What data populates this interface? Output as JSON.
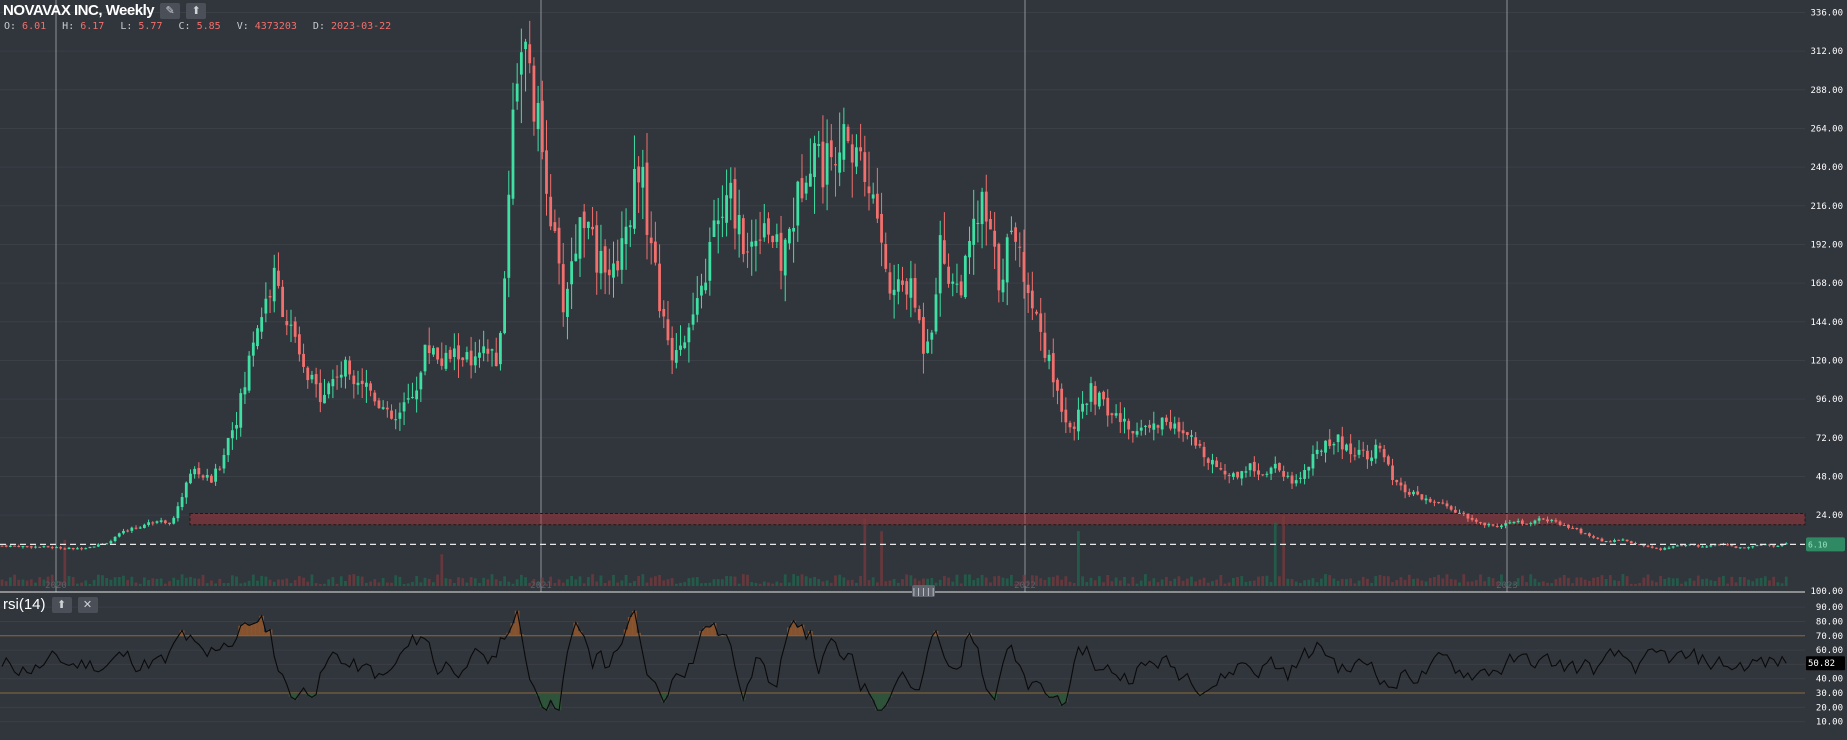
{
  "header": {
    "title": "NOVAVAX INC, Weekly",
    "ohlc": [
      {
        "key": "O:",
        "value": "6.01"
      },
      {
        "key": "H:",
        "value": "6.17"
      },
      {
        "key": "L:",
        "value": "5.77"
      },
      {
        "key": "C:",
        "value": "5.85"
      },
      {
        "key": "V:",
        "value": "4373203"
      },
      {
        "key": "D:",
        "value": "2023-03-22"
      }
    ]
  },
  "rsi_panel": {
    "title": "rsi(14)"
  },
  "colors": {
    "background": "#31353c",
    "grid": "#3b3f46",
    "up": "#3fe0a4",
    "down": "#f1706d",
    "rsi_line": "#0a0a0a",
    "rsi_overbought_fill": "#9a5a2c",
    "rsi_oversold_fill": "#2f5a3a",
    "resistance_zone": "#b5343a",
    "last_price_badge": "#2f8a64"
  },
  "icons": [
    "pencil-icon",
    "up-arrow-icon",
    "close-icon",
    "drag-handle-icon"
  ],
  "chart_data": [
    {
      "type": "candlestick",
      "series_name": "NOVAVAX INC",
      "interval": "Weekly",
      "x_tick_labels": [
        "2020",
        "2021",
        "2022",
        "2023"
      ],
      "y_tick_labels": [
        "336.00",
        "312.00",
        "288.00",
        "264.00",
        "240.00",
        "216.00",
        "192.00",
        "168.00",
        "144.00",
        "120.00",
        "96.00",
        "72.00",
        "48.00",
        "24.00",
        "100.00"
      ],
      "ylim": [
        -20,
        340
      ],
      "last_price": 5.85,
      "last_price_label": "6.10",
      "resistance_zone": [
        18,
        25
      ],
      "approx_close_path": [
        [
          0,
          5
        ],
        [
          12,
          4
        ],
        [
          18,
          3
        ],
        [
          22,
          5
        ],
        [
          24,
          6
        ],
        [
          26,
          8
        ],
        [
          28,
          12
        ],
        [
          30,
          15
        ],
        [
          33,
          17
        ],
        [
          36,
          20
        ],
        [
          38,
          22
        ],
        [
          40,
          18
        ],
        [
          42,
          28
        ],
        [
          44,
          45
        ],
        [
          46,
          52
        ],
        [
          48,
          48
        ],
        [
          50,
          45
        ],
        [
          52,
          55
        ],
        [
          54,
          72
        ],
        [
          56,
          85
        ],
        [
          58,
          105
        ],
        [
          60,
          135
        ],
        [
          62,
          150
        ],
        [
          63,
          158
        ],
        [
          65,
          170
        ],
        [
          67,
          155
        ],
        [
          68,
          145
        ],
        [
          70,
          130
        ],
        [
          72,
          112
        ],
        [
          74,
          105
        ],
        [
          76,
          100
        ],
        [
          78,
          105
        ],
        [
          80,
          112
        ],
        [
          82,
          115
        ],
        [
          84,
          112
        ],
        [
          86,
          108
        ],
        [
          88,
          102
        ],
        [
          90,
          95
        ],
        [
          92,
          85
        ],
        [
          94,
          82
        ],
        [
          96,
          90
        ],
        [
          98,
          100
        ],
        [
          100,
          112
        ],
        [
          101,
          125
        ],
        [
          103,
          130
        ],
        [
          105,
          118
        ],
        [
          107,
          122
        ],
        [
          110,
          125
        ],
        [
          112,
          115
        ],
        [
          114,
          120
        ],
        [
          116,
          125
        ],
        [
          118,
          122
        ],
        [
          119,
          130
        ],
        [
          120,
          170
        ],
        [
          121,
          230
        ],
        [
          122,
          280
        ],
        [
          123,
          300
        ],
        [
          124,
          320
        ],
        [
          125,
          310
        ],
        [
          126,
          290
        ],
        [
          128,
          265
        ],
        [
          130,
          235
        ],
        [
          132,
          190
        ],
        [
          134,
          155
        ],
        [
          136,
          180
        ],
        [
          138,
          205
        ],
        [
          140,
          215
        ],
        [
          142,
          170
        ],
        [
          144,
          185
        ],
        [
          146,
          175
        ],
        [
          148,
          195
        ],
        [
          150,
          215
        ],
        [
          152,
          245
        ],
        [
          154,
          210
        ],
        [
          156,
          175
        ],
        [
          158,
          140
        ],
        [
          160,
          125
        ],
        [
          162,
          135
        ],
        [
          164,
          140
        ],
        [
          166,
          150
        ],
        [
          168,
          175
        ],
        [
          170,
          200
        ],
        [
          172,
          210
        ],
        [
          174,
          220
        ],
        [
          176,
          205
        ],
        [
          178,
          185
        ],
        [
          180,
          200
        ],
        [
          182,
          210
        ],
        [
          184,
          195
        ],
        [
          186,
          180
        ],
        [
          188,
          200
        ],
        [
          190,
          220
        ],
        [
          192,
          245
        ],
        [
          194,
          255
        ],
        [
          196,
          240
        ],
        [
          198,
          250
        ],
        [
          200,
          262
        ],
        [
          202,
          245
        ],
        [
          204,
          255
        ],
        [
          206,
          235
        ],
        [
          208,
          220
        ],
        [
          210,
          195
        ],
        [
          212,
          160
        ],
        [
          214,
          165
        ],
        [
          216,
          168
        ],
        [
          218,
          155
        ],
        [
          220,
          130
        ],
        [
          222,
          145
        ],
        [
          224,
          190
        ],
        [
          226,
          175
        ],
        [
          228,
          165
        ],
        [
          230,
          175
        ],
        [
          232,
          200
        ],
        [
          234,
          215
        ],
        [
          236,
          195
        ],
        [
          238,
          170
        ],
        [
          240,
          190
        ],
        [
          242,
          200
        ],
        [
          244,
          175
        ],
        [
          246,
          155
        ],
        [
          248,
          140
        ],
        [
          250,
          118
        ],
        [
          252,
          100
        ],
        [
          254,
          85
        ],
        [
          256,
          80
        ],
        [
          258,
          90
        ],
        [
          260,
          100
        ],
        [
          262,
          95
        ],
        [
          264,
          88
        ],
        [
          266,
          85
        ],
        [
          268,
          80
        ],
        [
          270,
          75
        ],
        [
          272,
          82
        ],
        [
          274,
          78
        ],
        [
          276,
          80
        ],
        [
          278,
          85
        ],
        [
          280,
          78
        ],
        [
          282,
          72
        ],
        [
          284,
          70
        ],
        [
          286,
          65
        ],
        [
          288,
          60
        ],
        [
          290,
          55
        ],
        [
          292,
          50
        ],
        [
          294,
          48
        ],
        [
          296,
          52
        ],
        [
          298,
          55
        ],
        [
          300,
          50
        ],
        [
          302,
          52
        ],
        [
          304,
          55
        ],
        [
          306,
          50
        ],
        [
          308,
          45
        ],
        [
          310,
          48
        ],
        [
          312,
          55
        ],
        [
          314,
          62
        ],
        [
          316,
          70
        ],
        [
          318,
          72
        ],
        [
          320,
          68
        ],
        [
          322,
          63
        ],
        [
          324,
          65
        ],
        [
          326,
          62
        ],
        [
          328,
          65
        ],
        [
          330,
          60
        ],
        [
          332,
          45
        ],
        [
          334,
          40
        ],
        [
          336,
          38
        ],
        [
          338,
          35
        ],
        [
          340,
          33
        ],
        [
          342,
          32
        ],
        [
          344,
          30
        ],
        [
          346,
          28
        ],
        [
          348,
          25
        ],
        [
          350,
          22
        ],
        [
          352,
          20
        ],
        [
          354,
          18
        ],
        [
          356,
          17
        ],
        [
          358,
          18
        ],
        [
          360,
          19
        ],
        [
          362,
          20
        ],
        [
          364,
          18
        ],
        [
          366,
          20
        ],
        [
          368,
          22
        ],
        [
          370,
          20
        ],
        [
          372,
          18
        ],
        [
          374,
          16
        ],
        [
          376,
          15
        ],
        [
          378,
          12
        ],
        [
          380,
          10
        ],
        [
          382,
          8
        ],
        [
          384,
          7
        ],
        [
          386,
          9
        ],
        [
          388,
          8
        ],
        [
          390,
          6
        ],
        [
          392,
          5
        ],
        [
          394,
          4
        ],
        [
          396,
          3
        ],
        [
          398,
          4
        ],
        [
          400,
          5
        ],
        [
          402,
          6
        ],
        [
          404,
          5
        ],
        [
          406,
          4
        ],
        [
          408,
          5
        ],
        [
          410,
          6
        ],
        [
          412,
          5
        ],
        [
          414,
          4
        ],
        [
          416,
          4
        ],
        [
          418,
          5
        ],
        [
          420,
          6
        ],
        [
          422,
          5
        ],
        [
          424,
          5
        ],
        [
          426,
          6
        ]
      ]
    },
    {
      "type": "line",
      "series_name": "rsi(14)",
      "y_tick_labels": [
        "90.00",
        "80.00",
        "70.00",
        "60.00",
        "50.00",
        "40.00",
        "30.00",
        "20.00",
        "10.00"
      ],
      "ylim": [
        0,
        95
      ],
      "overbought": 70,
      "oversold": 30,
      "last_value": 50.82,
      "last_value_label": "50.82"
    }
  ]
}
